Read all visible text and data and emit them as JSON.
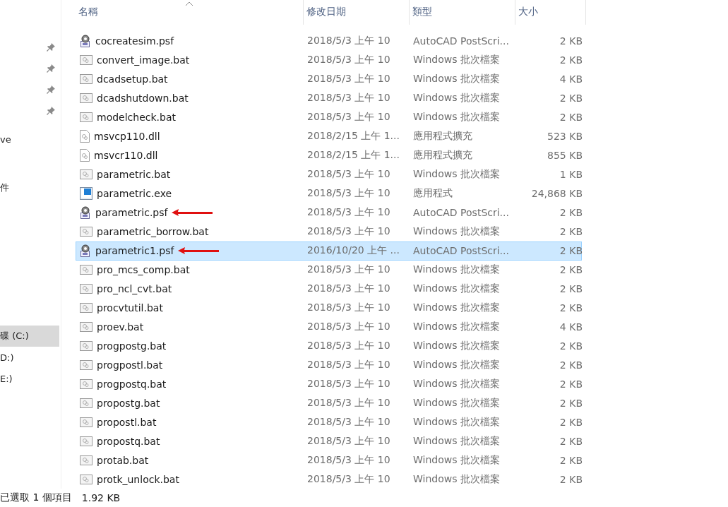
{
  "sidebar": {
    "items": [
      {
        "pinned": true
      },
      {
        "pinned": true
      },
      {
        "pinned": true
      },
      {
        "pinned": true
      },
      {
        "label": "ve",
        "selected": false
      },
      {
        "label": "件",
        "selected": false
      },
      {
        "label": "碟 (C:)",
        "selected": true
      },
      {
        "label": "D:)",
        "selected": false
      },
      {
        "label": "E:)",
        "selected": false
      }
    ]
  },
  "table": {
    "columns": [
      {
        "label": "名稱",
        "sorted": true
      },
      {
        "label": "修改日期",
        "sorted": false
      },
      {
        "label": "類型",
        "sorted": false
      },
      {
        "label": "大小",
        "sorted": false
      }
    ],
    "rows": [
      {
        "kind": "psf",
        "name": "cocreatesim.psf",
        "date": "2018/5/3 上午 10",
        "type": "AutoCAD PostScri...",
        "size": "2 KB",
        "selected": false,
        "arrow": false
      },
      {
        "kind": "bat",
        "name": "convert_image.bat",
        "date": "2018/5/3 上午 10",
        "type": "Windows 批次檔案",
        "size": "2 KB",
        "selected": false,
        "arrow": false
      },
      {
        "kind": "bat",
        "name": "dcadsetup.bat",
        "date": "2018/5/3 上午 10",
        "type": "Windows 批次檔案",
        "size": "4 KB",
        "selected": false,
        "arrow": false
      },
      {
        "kind": "bat",
        "name": "dcadshutdown.bat",
        "date": "2018/5/3 上午 10",
        "type": "Windows 批次檔案",
        "size": "2 KB",
        "selected": false,
        "arrow": false
      },
      {
        "kind": "bat",
        "name": "modelcheck.bat",
        "date": "2018/5/3 上午 10",
        "type": "Windows 批次檔案",
        "size": "2 KB",
        "selected": false,
        "arrow": false
      },
      {
        "kind": "dll",
        "name": "msvcp110.dll",
        "date": "2018/2/15 上午 1...",
        "type": "應用程式擴充",
        "size": "523 KB",
        "selected": false,
        "arrow": false
      },
      {
        "kind": "dll",
        "name": "msvcr110.dll",
        "date": "2018/2/15 上午 1...",
        "type": "應用程式擴充",
        "size": "855 KB",
        "selected": false,
        "arrow": false
      },
      {
        "kind": "bat",
        "name": "parametric.bat",
        "date": "2018/5/3 上午 10",
        "type": "Windows 批次檔案",
        "size": "1 KB",
        "selected": false,
        "arrow": false
      },
      {
        "kind": "exe",
        "name": "parametric.exe",
        "date": "2018/5/3 上午 10",
        "type": "應用程式",
        "size": "24,868 KB",
        "selected": false,
        "arrow": false
      },
      {
        "kind": "psf",
        "name": "parametric.psf",
        "date": "2018/5/3 上午 10",
        "type": "AutoCAD PostScri...",
        "size": "2 KB",
        "selected": false,
        "arrow": true
      },
      {
        "kind": "bat",
        "name": "parametric_borrow.bat",
        "date": "2018/5/3 上午 10",
        "type": "Windows 批次檔案",
        "size": "2 KB",
        "selected": false,
        "arrow": false
      },
      {
        "kind": "psf",
        "name": "parametric1.psf",
        "date": "2016/10/20 上午 ...",
        "type": "AutoCAD PostScri...",
        "size": "2 KB",
        "selected": true,
        "arrow": true
      },
      {
        "kind": "bat",
        "name": "pro_mcs_comp.bat",
        "date": "2018/5/3 上午 10",
        "type": "Windows 批次檔案",
        "size": "2 KB",
        "selected": false,
        "arrow": false
      },
      {
        "kind": "bat",
        "name": "pro_ncl_cvt.bat",
        "date": "2018/5/3 上午 10",
        "type": "Windows 批次檔案",
        "size": "2 KB",
        "selected": false,
        "arrow": false
      },
      {
        "kind": "bat",
        "name": "procvtutil.bat",
        "date": "2018/5/3 上午 10",
        "type": "Windows 批次檔案",
        "size": "2 KB",
        "selected": false,
        "arrow": false
      },
      {
        "kind": "bat",
        "name": "proev.bat",
        "date": "2018/5/3 上午 10",
        "type": "Windows 批次檔案",
        "size": "4 KB",
        "selected": false,
        "arrow": false
      },
      {
        "kind": "bat",
        "name": "progpostg.bat",
        "date": "2018/5/3 上午 10",
        "type": "Windows 批次檔案",
        "size": "2 KB",
        "selected": false,
        "arrow": false
      },
      {
        "kind": "bat",
        "name": "progpostl.bat",
        "date": "2018/5/3 上午 10",
        "type": "Windows 批次檔案",
        "size": "2 KB",
        "selected": false,
        "arrow": false
      },
      {
        "kind": "bat",
        "name": "progpostq.bat",
        "date": "2018/5/3 上午 10",
        "type": "Windows 批次檔案",
        "size": "2 KB",
        "selected": false,
        "arrow": false
      },
      {
        "kind": "bat",
        "name": "propostg.bat",
        "date": "2018/5/3 上午 10",
        "type": "Windows 批次檔案",
        "size": "2 KB",
        "selected": false,
        "arrow": false
      },
      {
        "kind": "bat",
        "name": "propostl.bat",
        "date": "2018/5/3 上午 10",
        "type": "Windows 批次檔案",
        "size": "2 KB",
        "selected": false,
        "arrow": false
      },
      {
        "kind": "bat",
        "name": "propostq.bat",
        "date": "2018/5/3 上午 10",
        "type": "Windows 批次檔案",
        "size": "2 KB",
        "selected": false,
        "arrow": false
      },
      {
        "kind": "bat",
        "name": "protab.bat",
        "date": "2018/5/3 上午 10",
        "type": "Windows 批次檔案",
        "size": "2 KB",
        "selected": false,
        "arrow": false
      },
      {
        "kind": "bat",
        "name": "protk_unlock.bat",
        "date": "2018/5/3 上午 10",
        "type": "Windows 批次檔案",
        "size": "2 KB",
        "selected": false,
        "arrow": false
      }
    ]
  },
  "status_bar": {
    "selection": "已選取 1 個項目",
    "size": "1.92 KB"
  }
}
